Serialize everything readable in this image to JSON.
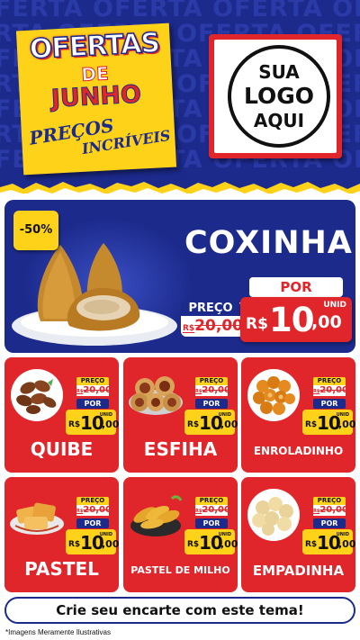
{
  "header": {
    "watermark_word": "OFERTA",
    "sticker": {
      "title": "OFERTAS",
      "connector": "DE",
      "month": "JUNHO",
      "tagline_line1": "PREÇOS",
      "tagline_line2": "INCRÍVEIS"
    },
    "logo": {
      "line1": "SUA",
      "line2": "LOGO",
      "line3": "AQUI"
    }
  },
  "hero": {
    "badge": "-50%",
    "product_name": "COXINHA",
    "old_label": "PREÇO",
    "old_currency": "R$",
    "old_price": "20,00",
    "por_label": "POR",
    "currency": "R$",
    "price_int": "10",
    "price_dec": ",00",
    "unit": "UNID"
  },
  "cards": [
    {
      "name": "QUIBE",
      "old_label": "PREÇO",
      "old_currency": "R$",
      "old_price": "20,00",
      "por_label": "POR",
      "currency": "R$",
      "price_int": "10",
      "price_dec": ",00",
      "unit": "UNID"
    },
    {
      "name": "ESFIHA",
      "old_label": "PREÇO",
      "old_currency": "R$",
      "old_price": "20,00",
      "por_label": "POR",
      "currency": "R$",
      "price_int": "10",
      "price_dec": ",00",
      "unit": "UNID"
    },
    {
      "name": "ENROLADINHO",
      "old_label": "PREÇO",
      "old_currency": "R$",
      "old_price": "20,00",
      "por_label": "POR",
      "currency": "R$",
      "price_int": "10",
      "price_dec": ",00",
      "unit": "UNID"
    },
    {
      "name": "PASTEL",
      "old_label": "PREÇO",
      "old_currency": "R$",
      "old_price": "20,00",
      "por_label": "POR",
      "currency": "R$",
      "price_int": "10",
      "price_dec": ",00",
      "unit": "UNID"
    },
    {
      "name": "PASTEL DE MILHO",
      "old_label": "PREÇO",
      "old_currency": "R$",
      "old_price": "20,00",
      "por_label": "POR",
      "currency": "R$",
      "price_int": "10",
      "price_dec": ",00",
      "unit": "UNID"
    },
    {
      "name": "EMPADINHA",
      "old_label": "PREÇO",
      "old_currency": "R$",
      "old_price": "20,00",
      "por_label": "POR",
      "currency": "R$",
      "price_int": "10",
      "price_dec": ",00",
      "unit": "UNID"
    }
  ],
  "footer": {
    "cta_label": "Crie seu encarte com este tema!",
    "disclaimer": "*Imagens Meramente Ilustrativas"
  },
  "colors": {
    "brand_blue": "#1c2a8c",
    "brand_red": "#e0252b",
    "brand_yellow": "#ffd21a"
  }
}
